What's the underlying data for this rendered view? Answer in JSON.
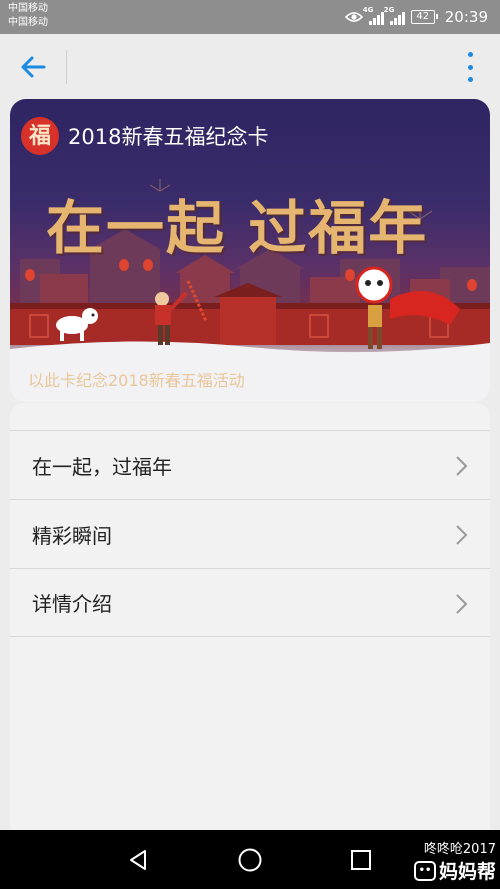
{
  "status_bar": {
    "carrier_1": "中国移动",
    "carrier_2": "中国移动",
    "network_1": "4G",
    "network_2": "2G",
    "battery": "42",
    "time": "20:39"
  },
  "toolbar": {
    "back_icon": "arrow-left-icon",
    "more_icon": "more-vertical-icon",
    "accent_color": "#1d8ae2"
  },
  "card": {
    "badge": "福",
    "title": "2018新春五福纪念卡",
    "slogan": "在一起 过福年",
    "subtitle": "以此卡纪念2018新春五福活动"
  },
  "list": {
    "items": [
      {
        "label": "在一起，过福年"
      },
      {
        "label": "精彩瞬间"
      },
      {
        "label": "详情介绍"
      }
    ]
  },
  "watermark": {
    "user": "咚咚呛2017",
    "brand": "妈妈帮"
  }
}
